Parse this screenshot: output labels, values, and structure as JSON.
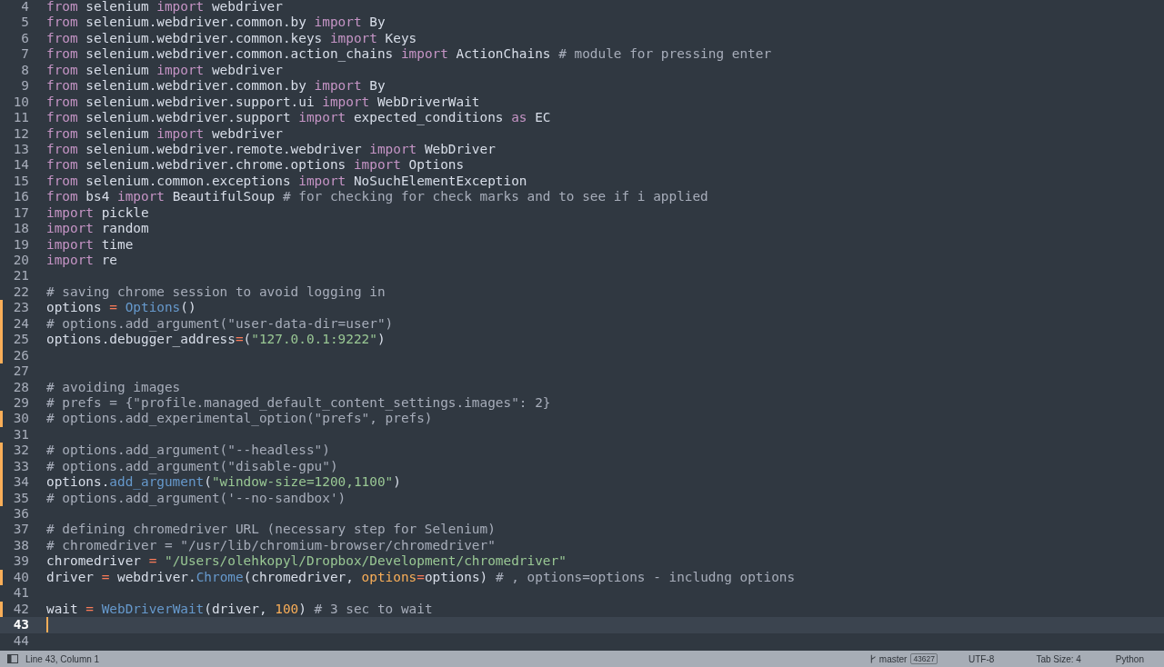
{
  "editor": {
    "lines": [
      {
        "number": "4",
        "modified": false,
        "current": false,
        "tokens": [
          {
            "kind": "keyword",
            "text": "from"
          },
          {
            "kind": "plain",
            "text": " selenium "
          },
          {
            "kind": "keyword",
            "text": "import"
          },
          {
            "kind": "plain",
            "text": " webdriver"
          }
        ]
      },
      {
        "number": "5",
        "modified": false,
        "current": false,
        "tokens": [
          {
            "kind": "keyword",
            "text": "from"
          },
          {
            "kind": "plain",
            "text": " selenium.webdriver.common.by "
          },
          {
            "kind": "keyword",
            "text": "import"
          },
          {
            "kind": "plain",
            "text": " By"
          }
        ]
      },
      {
        "number": "6",
        "modified": false,
        "current": false,
        "tokens": [
          {
            "kind": "keyword",
            "text": "from"
          },
          {
            "kind": "plain",
            "text": " selenium.webdriver.common.keys "
          },
          {
            "kind": "keyword",
            "text": "import"
          },
          {
            "kind": "plain",
            "text": " Keys"
          }
        ]
      },
      {
        "number": "7",
        "modified": false,
        "current": false,
        "tokens": [
          {
            "kind": "keyword",
            "text": "from"
          },
          {
            "kind": "plain",
            "text": " selenium.webdriver.common.action_chains "
          },
          {
            "kind": "keyword",
            "text": "import"
          },
          {
            "kind": "plain",
            "text": " ActionChains "
          },
          {
            "kind": "comment",
            "text": "# module for pressing enter"
          }
        ]
      },
      {
        "number": "8",
        "modified": false,
        "current": false,
        "tokens": [
          {
            "kind": "keyword",
            "text": "from"
          },
          {
            "kind": "plain",
            "text": " selenium "
          },
          {
            "kind": "keyword",
            "text": "import"
          },
          {
            "kind": "plain",
            "text": " webdriver"
          }
        ]
      },
      {
        "number": "9",
        "modified": false,
        "current": false,
        "tokens": [
          {
            "kind": "keyword",
            "text": "from"
          },
          {
            "kind": "plain",
            "text": " selenium.webdriver.common.by "
          },
          {
            "kind": "keyword",
            "text": "import"
          },
          {
            "kind": "plain",
            "text": " By"
          }
        ]
      },
      {
        "number": "10",
        "modified": false,
        "current": false,
        "tokens": [
          {
            "kind": "keyword",
            "text": "from"
          },
          {
            "kind": "plain",
            "text": " selenium.webdriver.support.ui "
          },
          {
            "kind": "keyword",
            "text": "import"
          },
          {
            "kind": "plain",
            "text": " WebDriverWait"
          }
        ]
      },
      {
        "number": "11",
        "modified": false,
        "current": false,
        "tokens": [
          {
            "kind": "keyword",
            "text": "from"
          },
          {
            "kind": "plain",
            "text": " selenium.webdriver.support "
          },
          {
            "kind": "keyword",
            "text": "import"
          },
          {
            "kind": "plain",
            "text": " expected_conditions "
          },
          {
            "kind": "keyword",
            "text": "as"
          },
          {
            "kind": "plain",
            "text": " EC"
          }
        ]
      },
      {
        "number": "12",
        "modified": false,
        "current": false,
        "tokens": [
          {
            "kind": "keyword",
            "text": "from"
          },
          {
            "kind": "plain",
            "text": " selenium "
          },
          {
            "kind": "keyword",
            "text": "import"
          },
          {
            "kind": "plain",
            "text": " webdriver"
          }
        ]
      },
      {
        "number": "13",
        "modified": false,
        "current": false,
        "tokens": [
          {
            "kind": "keyword",
            "text": "from"
          },
          {
            "kind": "plain",
            "text": " selenium.webdriver.remote.webdriver "
          },
          {
            "kind": "keyword",
            "text": "import"
          },
          {
            "kind": "plain",
            "text": " WebDriver"
          }
        ]
      },
      {
        "number": "14",
        "modified": false,
        "current": false,
        "tokens": [
          {
            "kind": "keyword",
            "text": "from"
          },
          {
            "kind": "plain",
            "text": " selenium.webdriver.chrome.options "
          },
          {
            "kind": "keyword",
            "text": "import"
          },
          {
            "kind": "plain",
            "text": " Options"
          }
        ]
      },
      {
        "number": "15",
        "modified": false,
        "current": false,
        "tokens": [
          {
            "kind": "keyword",
            "text": "from"
          },
          {
            "kind": "plain",
            "text": " selenium.common.exceptions "
          },
          {
            "kind": "keyword",
            "text": "import"
          },
          {
            "kind": "plain",
            "text": " NoSuchElementException"
          }
        ]
      },
      {
        "number": "16",
        "modified": false,
        "current": false,
        "tokens": [
          {
            "kind": "keyword",
            "text": "from"
          },
          {
            "kind": "plain",
            "text": " bs4 "
          },
          {
            "kind": "keyword",
            "text": "import"
          },
          {
            "kind": "plain",
            "text": " BeautifulSoup "
          },
          {
            "kind": "comment",
            "text": "# for checking for check marks and to see if i applied"
          }
        ]
      },
      {
        "number": "17",
        "modified": false,
        "current": false,
        "tokens": [
          {
            "kind": "keyword",
            "text": "import"
          },
          {
            "kind": "plain",
            "text": " pickle"
          }
        ]
      },
      {
        "number": "18",
        "modified": false,
        "current": false,
        "tokens": [
          {
            "kind": "keyword",
            "text": "import"
          },
          {
            "kind": "plain",
            "text": " random"
          }
        ]
      },
      {
        "number": "19",
        "modified": false,
        "current": false,
        "tokens": [
          {
            "kind": "keyword",
            "text": "import"
          },
          {
            "kind": "plain",
            "text": " time"
          }
        ]
      },
      {
        "number": "20",
        "modified": false,
        "current": false,
        "tokens": [
          {
            "kind": "keyword",
            "text": "import"
          },
          {
            "kind": "plain",
            "text": " re"
          }
        ]
      },
      {
        "number": "21",
        "modified": false,
        "current": false
      },
      {
        "number": "22",
        "modified": false,
        "current": false,
        "tokens": [
          {
            "kind": "comment",
            "text": "# saving chrome session to avoid logging in"
          }
        ]
      },
      {
        "number": "23",
        "modified": true,
        "current": false,
        "tokens": [
          {
            "kind": "plain",
            "text": "options "
          },
          {
            "kind": "operator",
            "text": "= "
          },
          {
            "kind": "function",
            "text": "Options"
          },
          {
            "kind": "plain",
            "text": "()"
          }
        ]
      },
      {
        "number": "24",
        "modified": true,
        "current": false,
        "tokens": [
          {
            "kind": "comment",
            "text": "# options.add_argument(\"user-data-dir=user\")"
          }
        ]
      },
      {
        "number": "25",
        "modified": true,
        "current": false,
        "tokens": [
          {
            "kind": "plain",
            "text": "options.debugger_address"
          },
          {
            "kind": "operator",
            "text": "="
          },
          {
            "kind": "plain",
            "text": "("
          },
          {
            "kind": "string",
            "text": "\"127.0.0.1:9222\""
          },
          {
            "kind": "plain",
            "text": ")"
          }
        ]
      },
      {
        "number": "26",
        "modified": true,
        "current": false
      },
      {
        "number": "27",
        "modified": false,
        "current": false
      },
      {
        "number": "28",
        "modified": false,
        "current": false,
        "tokens": [
          {
            "kind": "comment",
            "text": "# avoiding images"
          }
        ]
      },
      {
        "number": "29",
        "modified": false,
        "current": false,
        "tokens": [
          {
            "kind": "comment",
            "text": "# prefs = {\"profile.managed_default_content_settings.images\": 2}"
          }
        ]
      },
      {
        "number": "30",
        "modified": true,
        "current": false,
        "tokens": [
          {
            "kind": "comment",
            "text": "# options.add_experimental_option(\"prefs\", prefs)"
          }
        ]
      },
      {
        "number": "31",
        "modified": false,
        "current": false
      },
      {
        "number": "32",
        "modified": true,
        "current": false,
        "tokens": [
          {
            "kind": "comment",
            "text": "# options.add_argument(\"--headless\")"
          }
        ]
      },
      {
        "number": "33",
        "modified": true,
        "current": false,
        "tokens": [
          {
            "kind": "comment",
            "text": "# options.add_argument(\"disable-gpu\")"
          }
        ]
      },
      {
        "number": "34",
        "modified": true,
        "current": false,
        "tokens": [
          {
            "kind": "plain",
            "text": "options."
          },
          {
            "kind": "function",
            "text": "add_argument"
          },
          {
            "kind": "plain",
            "text": "("
          },
          {
            "kind": "string",
            "text": "\"window-size=1200,1100\""
          },
          {
            "kind": "plain",
            "text": ")"
          }
        ]
      },
      {
        "number": "35",
        "modified": true,
        "current": false,
        "tokens": [
          {
            "kind": "comment",
            "text": "# options.add_argument('--no-sandbox')"
          }
        ]
      },
      {
        "number": "36",
        "modified": false,
        "current": false
      },
      {
        "number": "37",
        "modified": false,
        "current": false,
        "tokens": [
          {
            "kind": "comment",
            "text": "# defining chromedriver URL (necessary step for Selenium)"
          }
        ]
      },
      {
        "number": "38",
        "modified": false,
        "current": false,
        "tokens": [
          {
            "kind": "comment",
            "text": "# chromedriver = \"/usr/lib/chromium-browser/chromedriver\""
          }
        ]
      },
      {
        "number": "39",
        "modified": false,
        "current": false,
        "tokens": [
          {
            "kind": "plain",
            "text": "chromedriver "
          },
          {
            "kind": "operator",
            "text": "= "
          },
          {
            "kind": "string",
            "text": "\"/Users/olehkopyl/Dropbox/Development/chromedriver\""
          }
        ]
      },
      {
        "number": "40",
        "modified": true,
        "current": false,
        "tokens": [
          {
            "kind": "plain",
            "text": "driver "
          },
          {
            "kind": "operator",
            "text": "="
          },
          {
            "kind": "plain",
            "text": " webdriver."
          },
          {
            "kind": "function",
            "text": "Chrome"
          },
          {
            "kind": "plain",
            "text": "(chromedriver, "
          },
          {
            "kind": "parameter",
            "text": "options"
          },
          {
            "kind": "operator",
            "text": "="
          },
          {
            "kind": "plain",
            "text": "options) "
          },
          {
            "kind": "comment",
            "text": "# , options=options - includng options"
          }
        ]
      },
      {
        "number": "41",
        "modified": false,
        "current": false
      },
      {
        "number": "42",
        "modified": true,
        "current": false,
        "tokens": [
          {
            "kind": "plain",
            "text": "wait "
          },
          {
            "kind": "operator",
            "text": "= "
          },
          {
            "kind": "function",
            "text": "WebDriverWait"
          },
          {
            "kind": "plain",
            "text": "(driver, "
          },
          {
            "kind": "number",
            "text": "100"
          },
          {
            "kind": "plain",
            "text": ") "
          },
          {
            "kind": "comment",
            "text": "# 3 sec to wait"
          }
        ]
      },
      {
        "number": "43",
        "modified": false,
        "current": true
      },
      {
        "number": "44",
        "modified": false,
        "current": false
      }
    ]
  },
  "status_bar": {
    "position": "Line 43, Column 1",
    "branch": "master",
    "branch_count": "43627",
    "encoding": "UTF-8",
    "tab_size": "Tab Size: 4",
    "syntax": "Python"
  }
}
